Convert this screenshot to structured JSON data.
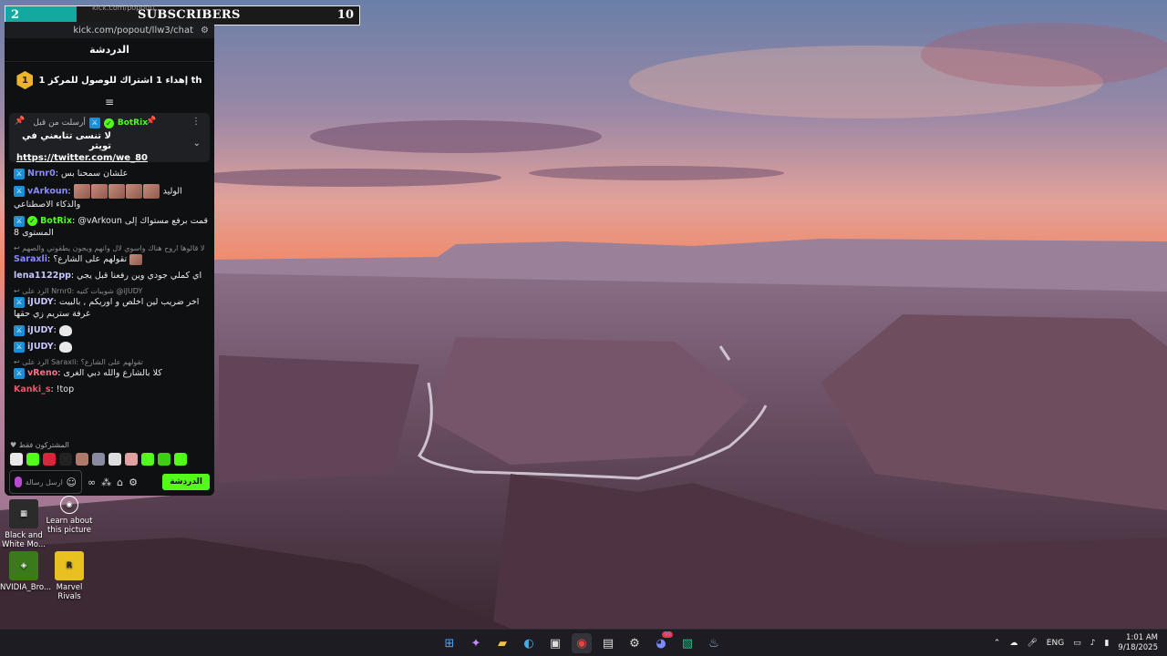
{
  "subscriber_goal": {
    "current": "2",
    "label": "SUBSCRIBERS",
    "target": "10",
    "progress_fraction": 0.2,
    "ghost_url": "kick.com/popout/"
  },
  "chat_window": {
    "url": "kick.com/popout/llw3/chat",
    "header": "الدردشة",
    "goal_text": "إهداء 1 اشتراك للوصول للمركز 1 th",
    "goal_badge": "1",
    "pinned": {
      "meta": "أرسلت من قبل",
      "bot_name": "BotRix",
      "title": "لا تنسى تتابعني في تويتر",
      "link": "https://twitter.com/we_80"
    },
    "messages": [
      {
        "user": "Nrnr0",
        "color": "#8b8bff",
        "text": "علشان سمحنا بس"
      },
      {
        "user": "vArkoun",
        "color": "#8b8bff",
        "text": "الوليد والذكاء الاصطناعي",
        "emotes": 5
      },
      {
        "user": "BotRix",
        "color": "#53fc18",
        "text": "@vArkoun قمت برفع مستواك إلى المستوى 8"
      },
      {
        "reply": "لا قالوها اروح هناك واسوي لال وانهم ويجون يطقوني والصهم",
        "user": "Saraxli",
        "color": "#8b8bff",
        "text": "تقولهم على الشارع؟"
      },
      {
        "user": "lena1122pp",
        "color": "#c8c8ff",
        "text": "اي كملي جودي وين رفعنا قبل يجي"
      },
      {
        "reply": "الرد على Nrnr0: شويبات كتيه @iJUDY",
        "user": "iJUDY",
        "color": "#c8c8ff",
        "text": "اخر ضريب لين اخلص و اوريكم , بالبيت غرفة ستريم زي حقها"
      },
      {
        "user": "iJUDY",
        "color": "#c8c8ff",
        "text": ""
      },
      {
        "user": "iJUDY",
        "color": "#c8c8ff",
        "text": ""
      },
      {
        "reply": "الرد على Saraxli: تقولهم على الشارع؟",
        "user": "vReno",
        "color": "#ff6b8a",
        "text": "كلا بالشارع والله دبي الغرى"
      },
      {
        "user": "Kanki_s",
        "color": "#ff4d6d",
        "text": "!top"
      }
    ],
    "subs_only_label": "المشتركون فقط",
    "input_placeholder": "ارسل رسالة",
    "send_label": "الدردشة"
  },
  "desktop_icons": [
    {
      "label": "Black and White Mo..."
    },
    {
      "label": "Learn about this picture"
    },
    {
      "label": "NVIDIA_Bro..."
    },
    {
      "label": "Marvel Rivals"
    }
  ],
  "taskbar": {
    "language": "ENG",
    "time": "1:01 AM",
    "date": "9/18/2025",
    "discord_badge": "99"
  }
}
